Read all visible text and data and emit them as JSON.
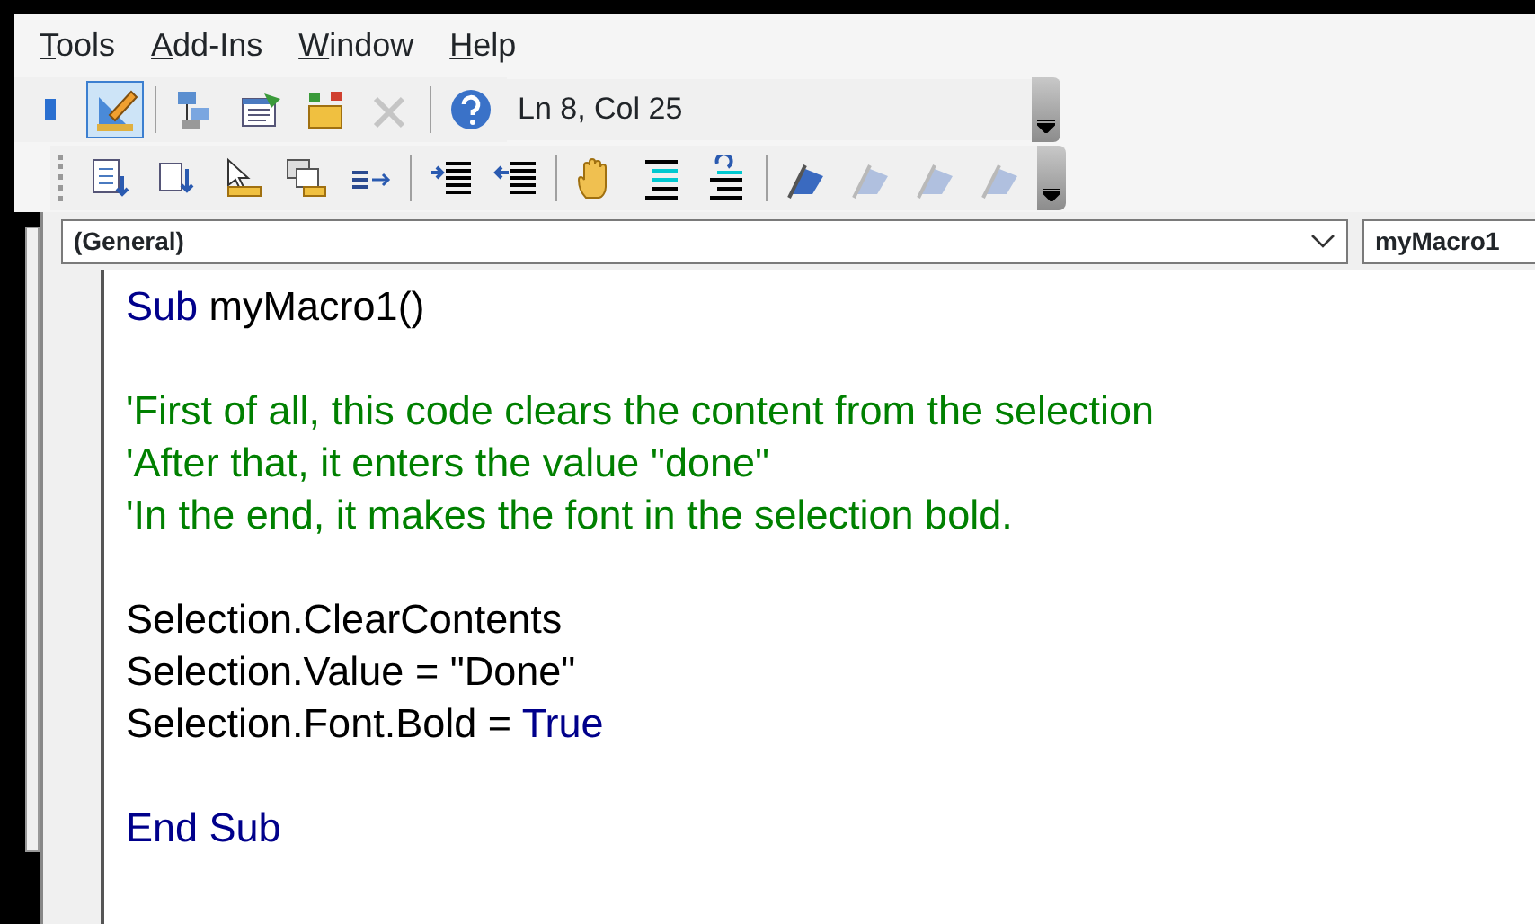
{
  "menu": [
    {
      "accel": "T",
      "rest": "ools"
    },
    {
      "accel": "A",
      "rest": "dd-Ins"
    },
    {
      "accel": "W",
      "rest": "indow"
    },
    {
      "accel": "H",
      "rest": "elp"
    }
  ],
  "toolbar_1": {
    "items": [
      {
        "kind": "cut-blue",
        "selected": false,
        "disabled": false
      },
      {
        "kind": "design",
        "selected": true,
        "disabled": false
      },
      {
        "kind": "separator"
      },
      {
        "kind": "project",
        "selected": false,
        "disabled": false
      },
      {
        "kind": "properties",
        "selected": false,
        "disabled": false
      },
      {
        "kind": "browser",
        "selected": false,
        "disabled": false
      },
      {
        "kind": "tools",
        "selected": false,
        "disabled": true
      },
      {
        "kind": "separator"
      },
      {
        "kind": "help",
        "selected": false,
        "disabled": false
      }
    ],
    "status": "Ln 8, Col 25"
  },
  "toolbar_2": {
    "items": [
      {
        "kind": "list",
        "selected": false,
        "disabled": false
      },
      {
        "kind": "constants",
        "selected": false,
        "disabled": false
      },
      {
        "kind": "quickinfo",
        "selected": false,
        "disabled": false
      },
      {
        "kind": "paraminfo",
        "selected": false,
        "disabled": false
      },
      {
        "kind": "complete",
        "selected": false,
        "disabled": false
      },
      {
        "kind": "separator"
      },
      {
        "kind": "indent",
        "selected": false,
        "disabled": false
      },
      {
        "kind": "outdent",
        "selected": false,
        "disabled": false
      },
      {
        "kind": "separator"
      },
      {
        "kind": "hand",
        "selected": false,
        "disabled": false
      },
      {
        "kind": "comment",
        "selected": false,
        "disabled": false
      },
      {
        "kind": "uncomment",
        "selected": false,
        "disabled": false
      },
      {
        "kind": "separator"
      },
      {
        "kind": "bookmark",
        "selected": false,
        "disabled": false
      },
      {
        "kind": "bookmark",
        "selected": false,
        "disabled": true
      },
      {
        "kind": "bookmark",
        "selected": false,
        "disabled": true
      },
      {
        "kind": "bookmark",
        "selected": false,
        "disabled": true
      }
    ]
  },
  "object_combo": "(General)",
  "procedure_combo": "myMacro1",
  "code_lines": [
    {
      "kind": "code",
      "tokens": [
        {
          "kind": "keyword",
          "text": "Sub"
        },
        {
          "kind": "plain",
          "text": " myMacro1()"
        }
      ]
    },
    {
      "kind": "blank"
    },
    {
      "kind": "code",
      "tokens": [
        {
          "kind": "comment",
          "text": "'First of all, this code clears the content from the selection"
        }
      ]
    },
    {
      "kind": "code",
      "tokens": [
        {
          "kind": "comment",
          "text": "'After that, it enters the value \"done\""
        }
      ]
    },
    {
      "kind": "code",
      "tokens": [
        {
          "kind": "comment",
          "text": "'In the end, it makes the font in the selection bold."
        }
      ]
    },
    {
      "kind": "blank"
    },
    {
      "kind": "code",
      "tokens": [
        {
          "kind": "plain",
          "text": "Selection.ClearContents"
        }
      ]
    },
    {
      "kind": "code",
      "tokens": [
        {
          "kind": "plain",
          "text": "Selection.Value = \"Done\""
        }
      ]
    },
    {
      "kind": "code",
      "tokens": [
        {
          "kind": "plain",
          "text": "Selection.Font.Bold = "
        },
        {
          "kind": "keyword",
          "text": "True"
        }
      ]
    },
    {
      "kind": "blank"
    },
    {
      "kind": "code",
      "tokens": [
        {
          "kind": "keyword",
          "text": "End Sub"
        }
      ]
    }
  ]
}
